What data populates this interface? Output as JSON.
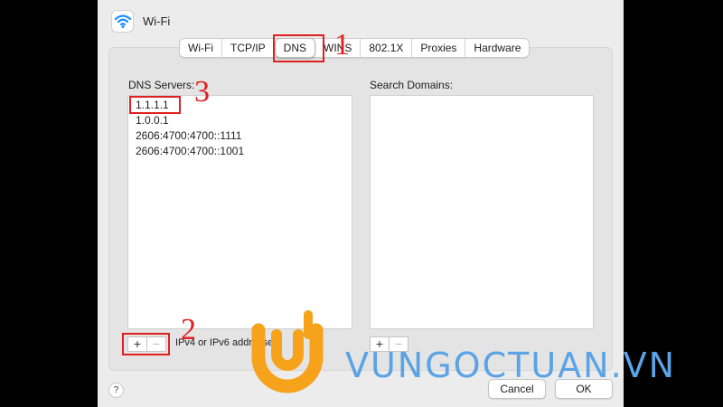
{
  "window": {
    "title": "Wi-Fi"
  },
  "tabs": [
    {
      "label": "Wi-Fi"
    },
    {
      "label": "TCP/IP"
    },
    {
      "label": "DNS"
    },
    {
      "label": "WINS"
    },
    {
      "label": "802.1X"
    },
    {
      "label": "Proxies"
    },
    {
      "label": "Hardware"
    }
  ],
  "selected_tab": "DNS",
  "dns": {
    "label": "DNS Servers:",
    "servers": [
      "1.1.1.1",
      "1.0.0.1",
      "2606:4700:4700::1111",
      "2606:4700:4700::1001"
    ],
    "hint": "IPv4 or IPv6 addresses",
    "add": "+",
    "remove": "−"
  },
  "search": {
    "label": "Search Domains:",
    "add": "+",
    "remove": "−"
  },
  "buttons": {
    "help": "?",
    "cancel": "Cancel",
    "ok": "OK"
  },
  "annotations": {
    "n1": "1",
    "n2": "2",
    "n3": "3"
  },
  "watermark": {
    "text": "VUNGOCTUAN.VN"
  },
  "colors": {
    "annotation": "#e02020",
    "watermark_blue": "#5aa3e6",
    "watermark_orange": "#f7a21b"
  }
}
